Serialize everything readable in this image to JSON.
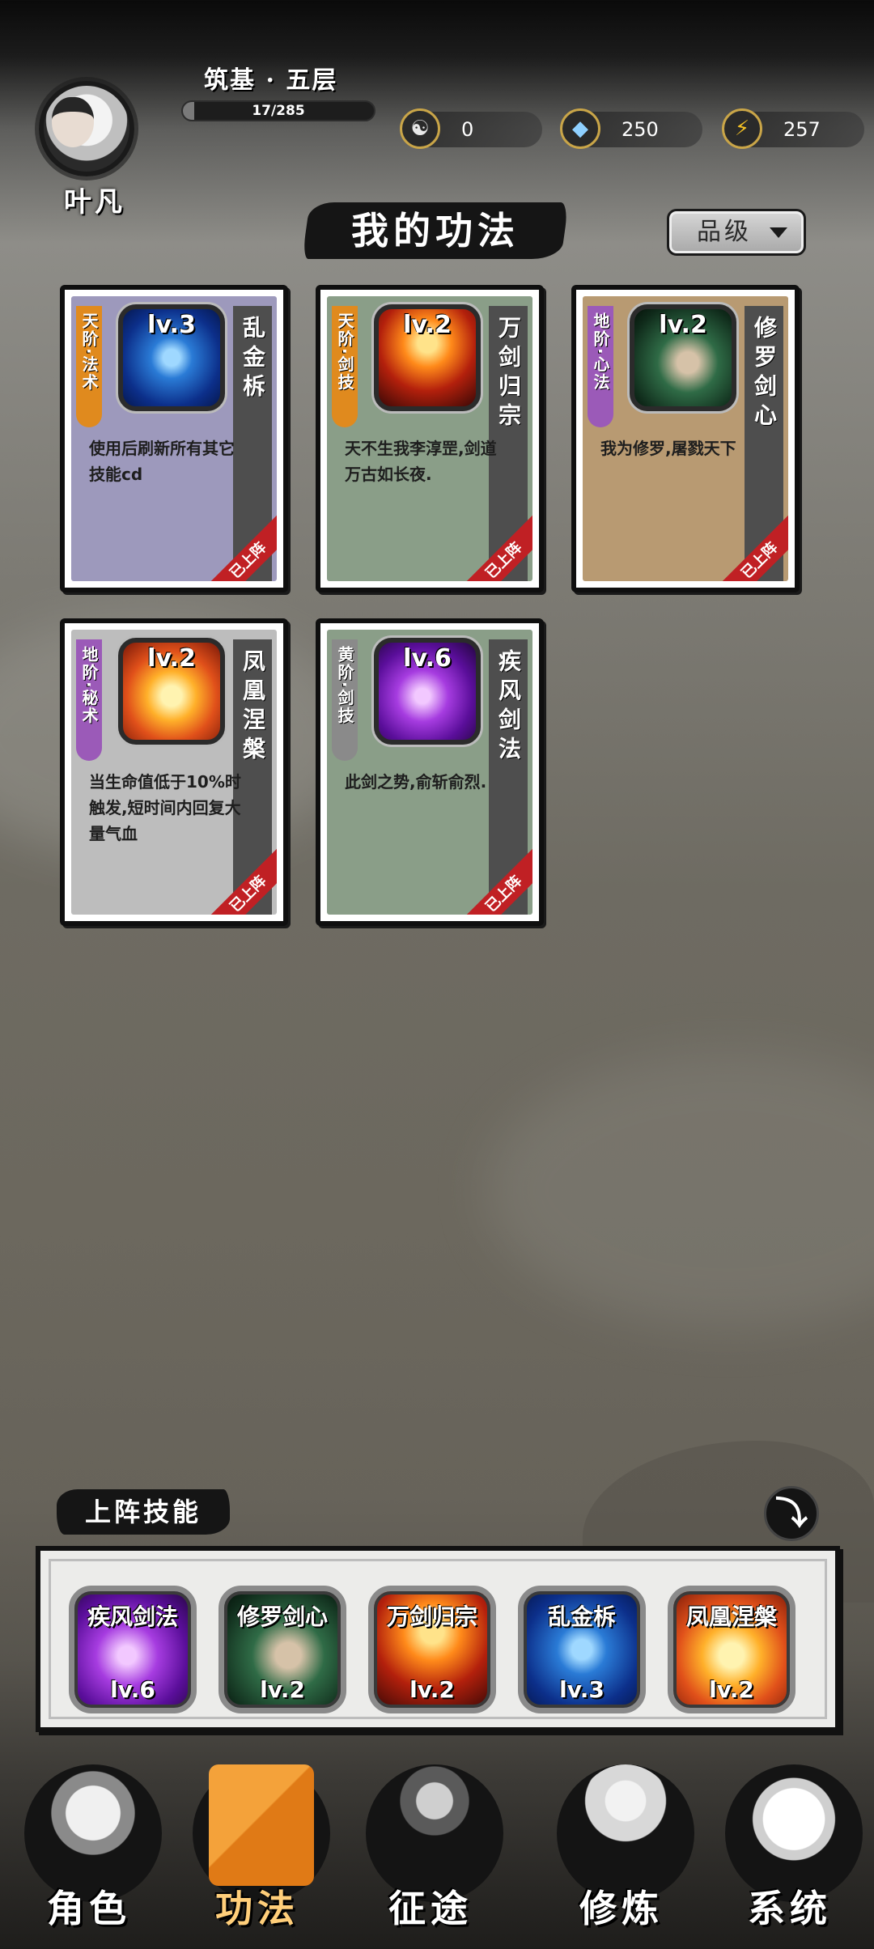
{
  "player": {
    "name": "叶凡",
    "realm": "筑基 · 五层",
    "xp_text": "17/285",
    "xp_progress": 0.06
  },
  "resources": [
    {
      "icon": "yin-yang-icon",
      "glyph": "☯",
      "value": "0"
    },
    {
      "icon": "spirit-stone-icon",
      "glyph": "◆",
      "value": "250"
    },
    {
      "icon": "lightning-icon",
      "glyph": "⚡",
      "value": "257"
    }
  ],
  "page_title": "我的功法",
  "sort": {
    "label": "品级"
  },
  "skills": [
    {
      "tier": "天阶·法术",
      "tier_color": "#e08a1e",
      "name": "乱金柝",
      "level": "lv.3",
      "desc": "使用后刷新所有其它技能cd",
      "bg": "#9d99bc",
      "art": "art-blue",
      "equipped": "已上阵"
    },
    {
      "tier": "天阶·剑技",
      "tier_color": "#e08a1e",
      "name": "万剑归宗",
      "level": "lv.2",
      "desc": "天不生我李淳罡,剑道万古如长夜.",
      "bg": "#8a9e88",
      "art": "art-fire",
      "equipped": "已上阵"
    },
    {
      "tier": "地阶·心法",
      "tier_color": "#9b5ab8",
      "name": "修罗剑心",
      "level": "lv.2",
      "desc": "我为修罗,屠戮天下",
      "bg": "#b89a72",
      "art": "art-green",
      "equipped": "已上阵"
    },
    {
      "tier": "地阶·秘术",
      "tier_color": "#9b5ab8",
      "name": "凤凰涅槃",
      "level": "lv.2",
      "desc": "当生命值低于10%时触发,短时间内回复大量气血",
      "bg": "#bdbdbd",
      "art": "art-phoenix",
      "equipped": "已上阵"
    },
    {
      "tier": "黄阶·剑技",
      "tier_color": "#8a8a8a",
      "name": "疾风剑法",
      "level": "lv.6",
      "desc": "此剑之势,俞斩俞烈.",
      "bg": "#8a9e88",
      "art": "art-purple",
      "equipped": "已上阵"
    }
  ],
  "equipped_section": {
    "title": "上阵技能",
    "collapse_glyph": "⤵"
  },
  "equipped_slots": [
    {
      "name": "疾风剑法",
      "level": "lv.6",
      "art": "art-purple"
    },
    {
      "name": "修罗剑心",
      "level": "lv.2",
      "art": "art-green"
    },
    {
      "name": "万剑归宗",
      "level": "lv.2",
      "art": "art-fire"
    },
    {
      "name": "乱金柝",
      "level": "lv.3",
      "art": "art-blue"
    },
    {
      "name": "凤凰涅槃",
      "level": "lv.2",
      "art": "art-phoenix"
    }
  ],
  "nav": [
    {
      "id": "character",
      "label": "角色",
      "icon": "hooded-figure-icon",
      "active": false
    },
    {
      "id": "skills",
      "label": "功法",
      "icon": "scroll-book-icon",
      "active": true
    },
    {
      "id": "journey",
      "label": "征途",
      "icon": "sword-emblem-icon",
      "active": false
    },
    {
      "id": "cultivate",
      "label": "修炼",
      "icon": "meditation-icon",
      "active": false
    },
    {
      "id": "system",
      "label": "系统",
      "icon": "mascot-icon",
      "active": false
    }
  ]
}
